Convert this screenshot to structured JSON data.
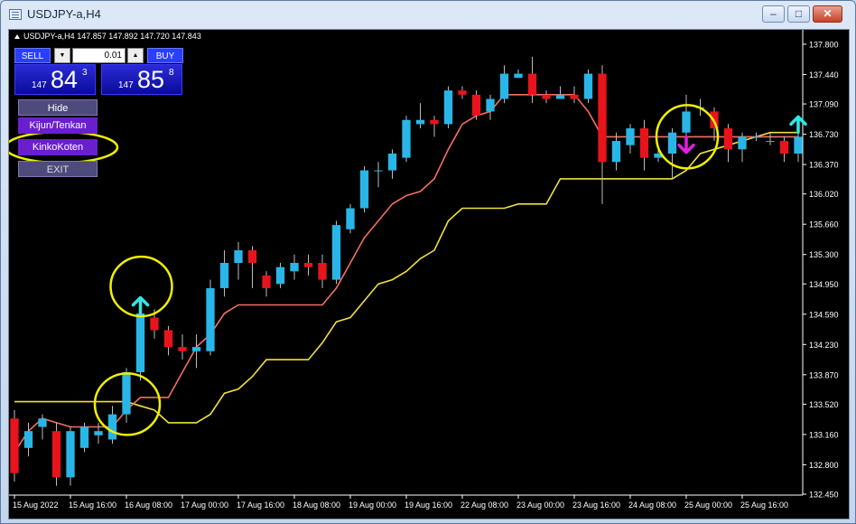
{
  "window": {
    "title": "USDJPY-a,H4"
  },
  "chart": {
    "header": "USDJPY-a,H4  147.857 147.892 147.720 147.843"
  },
  "trade_panel": {
    "sell_label": "SELL",
    "buy_label": "BUY",
    "lot_value": "0.01",
    "bid": {
      "prefix": "147",
      "big": "84",
      "sup": "3"
    },
    "ask": {
      "prefix": "147",
      "big": "85",
      "sup": "8"
    }
  },
  "menu": {
    "hide": "Hide",
    "kijun": "Kijun/Tenkan",
    "kinko": "KinkoKoten",
    "exit": "EXIT"
  },
  "colors": {
    "bull": "#29b6e6",
    "bear": "#e8141c",
    "tenkan": "#f07060",
    "kijun": "#f0e040",
    "up_arrow": "#2ee8e8",
    "down_arrow": "#e020e0",
    "highlight": "#f0f000"
  },
  "chart_data": {
    "type": "candlestick",
    "symbol": "USDJPY-a",
    "timeframe": "H4",
    "ylim": [
      132.45,
      137.95
    ],
    "yticks": [
      "137.800",
      "137.440",
      "137.090",
      "136.730",
      "136.370",
      "136.020",
      "135.660",
      "135.300",
      "134.950",
      "134.590",
      "134.230",
      "133.870",
      "133.520",
      "133.160",
      "132.800",
      "132.450"
    ],
    "ytick_values": [
      137.8,
      137.44,
      137.09,
      136.73,
      136.37,
      136.02,
      135.66,
      135.3,
      134.95,
      134.59,
      134.23,
      133.87,
      133.52,
      133.16,
      132.8,
      132.45
    ],
    "xticks": [
      "15 Aug 2022",
      "15 Aug 16:00",
      "16 Aug 08:00",
      "17 Aug 00:00",
      "17 Aug 16:00",
      "18 Aug 08:00",
      "19 Aug 00:00",
      "19 Aug 16:00",
      "22 Aug 08:00",
      "23 Aug 00:00",
      "23 Aug 16:00",
      "24 Aug 08:00",
      "25 Aug 00:00",
      "25 Aug 16:00"
    ],
    "xtick_index": [
      0,
      4,
      8,
      12,
      16,
      20,
      24,
      28,
      32,
      36,
      40,
      44,
      48,
      52
    ],
    "candles": [
      {
        "o": 133.35,
        "h": 133.45,
        "l": 132.6,
        "c": 132.7
      },
      {
        "o": 133.0,
        "h": 133.3,
        "l": 132.9,
        "c": 133.2
      },
      {
        "o": 133.25,
        "h": 133.4,
        "l": 133.1,
        "c": 133.35
      },
      {
        "o": 133.2,
        "h": 133.3,
        "l": 132.55,
        "c": 132.65
      },
      {
        "o": 132.65,
        "h": 133.25,
        "l": 132.55,
        "c": 133.2
      },
      {
        "o": 133.0,
        "h": 133.3,
        "l": 132.95,
        "c": 133.25
      },
      {
        "o": 133.15,
        "h": 133.3,
        "l": 133.05,
        "c": 133.2
      },
      {
        "o": 133.1,
        "h": 133.5,
        "l": 133.05,
        "c": 133.4
      },
      {
        "o": 133.4,
        "h": 133.95,
        "l": 133.3,
        "c": 133.9
      },
      {
        "o": 133.9,
        "h": 134.65,
        "l": 133.8,
        "c": 134.6
      },
      {
        "o": 134.55,
        "h": 134.65,
        "l": 134.3,
        "c": 134.4
      },
      {
        "o": 134.4,
        "h": 134.45,
        "l": 134.1,
        "c": 134.2
      },
      {
        "o": 134.2,
        "h": 134.35,
        "l": 134.05,
        "c": 134.15
      },
      {
        "o": 134.15,
        "h": 134.35,
        "l": 133.95,
        "c": 134.2
      },
      {
        "o": 134.15,
        "h": 135.0,
        "l": 134.1,
        "c": 134.9
      },
      {
        "o": 134.9,
        "h": 135.35,
        "l": 134.8,
        "c": 135.2
      },
      {
        "o": 135.2,
        "h": 135.45,
        "l": 135.0,
        "c": 135.35
      },
      {
        "o": 135.35,
        "h": 135.4,
        "l": 134.9,
        "c": 135.2
      },
      {
        "o": 135.05,
        "h": 135.1,
        "l": 134.8,
        "c": 134.9
      },
      {
        "o": 134.95,
        "h": 135.2,
        "l": 134.9,
        "c": 135.15
      },
      {
        "o": 135.1,
        "h": 135.3,
        "l": 135.0,
        "c": 135.2
      },
      {
        "o": 135.2,
        "h": 135.3,
        "l": 135.05,
        "c": 135.15
      },
      {
        "o": 135.2,
        "h": 135.3,
        "l": 134.9,
        "c": 135.0
      },
      {
        "o": 135.0,
        "h": 135.7,
        "l": 134.95,
        "c": 135.65
      },
      {
        "o": 135.6,
        "h": 135.9,
        "l": 135.55,
        "c": 135.85
      },
      {
        "o": 135.85,
        "h": 136.35,
        "l": 135.8,
        "c": 136.3
      },
      {
        "o": 136.3,
        "h": 136.4,
        "l": 136.1,
        "c": 136.3
      },
      {
        "o": 136.3,
        "h": 136.55,
        "l": 136.2,
        "c": 136.5
      },
      {
        "o": 136.45,
        "h": 136.95,
        "l": 136.4,
        "c": 136.9
      },
      {
        "o": 136.85,
        "h": 137.1,
        "l": 136.8,
        "c": 136.9
      },
      {
        "o": 136.9,
        "h": 136.95,
        "l": 136.7,
        "c": 136.85
      },
      {
        "o": 136.85,
        "h": 137.3,
        "l": 136.8,
        "c": 137.25
      },
      {
        "o": 137.25,
        "h": 137.3,
        "l": 137.15,
        "c": 137.2
      },
      {
        "o": 137.2,
        "h": 137.25,
        "l": 136.9,
        "c": 136.95
      },
      {
        "o": 137.0,
        "h": 137.2,
        "l": 136.9,
        "c": 137.15
      },
      {
        "o": 137.15,
        "h": 137.55,
        "l": 137.1,
        "c": 137.45
      },
      {
        "o": 137.4,
        "h": 137.5,
        "l": 137.4,
        "c": 137.45
      },
      {
        "o": 137.45,
        "h": 137.65,
        "l": 137.1,
        "c": 137.2
      },
      {
        "o": 137.2,
        "h": 137.25,
        "l": 137.1,
        "c": 137.15
      },
      {
        "o": 137.15,
        "h": 137.3,
        "l": 137.15,
        "c": 137.2
      },
      {
        "o": 137.2,
        "h": 137.3,
        "l": 137.1,
        "c": 137.15
      },
      {
        "o": 137.15,
        "h": 137.5,
        "l": 137.1,
        "c": 137.45
      },
      {
        "o": 137.45,
        "h": 137.55,
        "l": 135.9,
        "c": 136.4
      },
      {
        "o": 136.4,
        "h": 136.75,
        "l": 136.3,
        "c": 136.65
      },
      {
        "o": 136.6,
        "h": 136.85,
        "l": 136.5,
        "c": 136.8
      },
      {
        "o": 136.8,
        "h": 136.9,
        "l": 136.3,
        "c": 136.45
      },
      {
        "o": 136.45,
        "h": 136.6,
        "l": 136.4,
        "c": 136.5
      },
      {
        "o": 136.5,
        "h": 136.8,
        "l": 136.2,
        "c": 136.75
      },
      {
        "o": 136.75,
        "h": 137.2,
        "l": 136.7,
        "c": 137.0
      },
      {
        "o": 137.05,
        "h": 137.15,
        "l": 136.95,
        "c": 137.05
      },
      {
        "o": 137.0,
        "h": 137.05,
        "l": 136.65,
        "c": 136.8
      },
      {
        "o": 136.8,
        "h": 136.85,
        "l": 136.4,
        "c": 136.55
      },
      {
        "o": 136.55,
        "h": 136.75,
        "l": 136.4,
        "c": 136.7
      },
      {
        "o": 136.7,
        "h": 136.75,
        "l": 136.65,
        "c": 136.7
      },
      {
        "o": 136.65,
        "h": 136.75,
        "l": 136.6,
        "c": 136.65
      },
      {
        "o": 136.65,
        "h": 136.7,
        "l": 136.4,
        "c": 136.5
      },
      {
        "o": 136.5,
        "h": 136.75,
        "l": 136.4,
        "c": 136.7
      }
    ],
    "tenkan": [
      132.95,
      133.2,
      133.35,
      133.3,
      133.25,
      133.25,
      133.25,
      133.25,
      133.45,
      133.6,
      133.6,
      133.6,
      133.9,
      134.2,
      134.35,
      134.6,
      134.7,
      134.7,
      134.7,
      134.7,
      134.7,
      134.7,
      134.7,
      134.9,
      135.2,
      135.5,
      135.7,
      135.9,
      136.0,
      136.05,
      136.2,
      136.55,
      136.85,
      136.95,
      137.0,
      137.2,
      137.2,
      137.2,
      137.2,
      137.2,
      137.2,
      137.0,
      136.7,
      136.7,
      136.7,
      136.7,
      136.7,
      136.7,
      136.7,
      136.7,
      136.7,
      136.7,
      136.7,
      136.7,
      136.7,
      136.7,
      136.7
    ],
    "kijun": [
      133.55,
      133.55,
      133.55,
      133.55,
      133.55,
      133.55,
      133.55,
      133.55,
      133.55,
      133.5,
      133.45,
      133.3,
      133.3,
      133.3,
      133.4,
      133.65,
      133.7,
      133.85,
      134.05,
      134.05,
      134.05,
      134.05,
      134.25,
      134.5,
      134.55,
      134.75,
      134.95,
      135.0,
      135.1,
      135.25,
      135.35,
      135.7,
      135.85,
      135.85,
      135.85,
      135.85,
      135.9,
      135.9,
      135.9,
      136.2,
      136.2,
      136.2,
      136.2,
      136.2,
      136.2,
      136.2,
      136.2,
      136.2,
      136.3,
      136.5,
      136.55,
      136.6,
      136.65,
      136.7,
      136.75,
      136.75,
      136.75
    ],
    "signals": [
      {
        "index": 9,
        "direction": "up",
        "at": 134.7
      },
      {
        "index": 48,
        "direction": "down",
        "at": 136.6
      },
      {
        "index": 56,
        "direction": "up",
        "at": 136.85
      }
    ]
  }
}
